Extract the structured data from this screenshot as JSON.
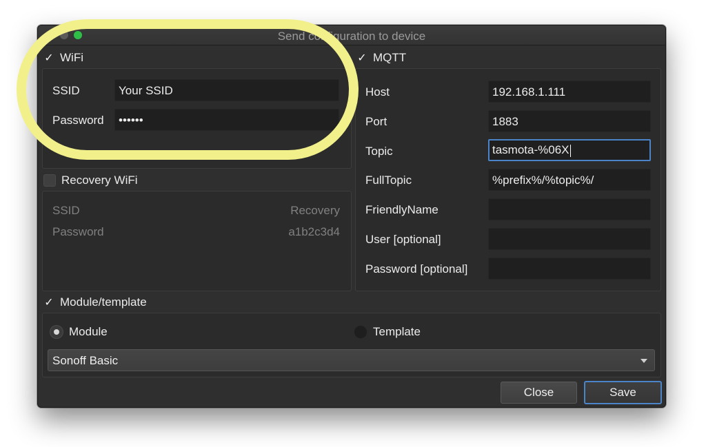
{
  "window": {
    "title": "Send configuration to device"
  },
  "wifi": {
    "header": "WiFi",
    "checked": true,
    "ssid_label": "SSID",
    "ssid_value": "Your SSID",
    "password_label": "Password",
    "password_value": "••••••"
  },
  "recovery": {
    "header": "Recovery WiFi",
    "checked": false,
    "ssid_label": "SSID",
    "ssid_value": "Recovery",
    "password_label": "Password",
    "password_value": "a1b2c3d4"
  },
  "mqtt": {
    "header": "MQTT",
    "checked": true,
    "fields": [
      {
        "label": "Host",
        "value": "192.168.1.111"
      },
      {
        "label": "Port",
        "value": "1883"
      },
      {
        "label": "Topic",
        "value": "tasmota-%06X"
      },
      {
        "label": "FullTopic",
        "value": "%prefix%/%topic%/"
      },
      {
        "label": "FriendlyName",
        "value": ""
      },
      {
        "label": "User [optional]",
        "value": ""
      },
      {
        "label": "Password [optional]",
        "value": ""
      }
    ]
  },
  "module": {
    "header": "Module/template",
    "checked": true,
    "radio_module": "Module",
    "radio_template": "Template",
    "selected": "Module",
    "dropdown_value": "Sonoff Basic"
  },
  "buttons": {
    "close": "Close",
    "save": "Save"
  },
  "colors": {
    "highlight": "#f2f08a",
    "focus": "#4b84c9",
    "maximize": "#2fbf47"
  }
}
